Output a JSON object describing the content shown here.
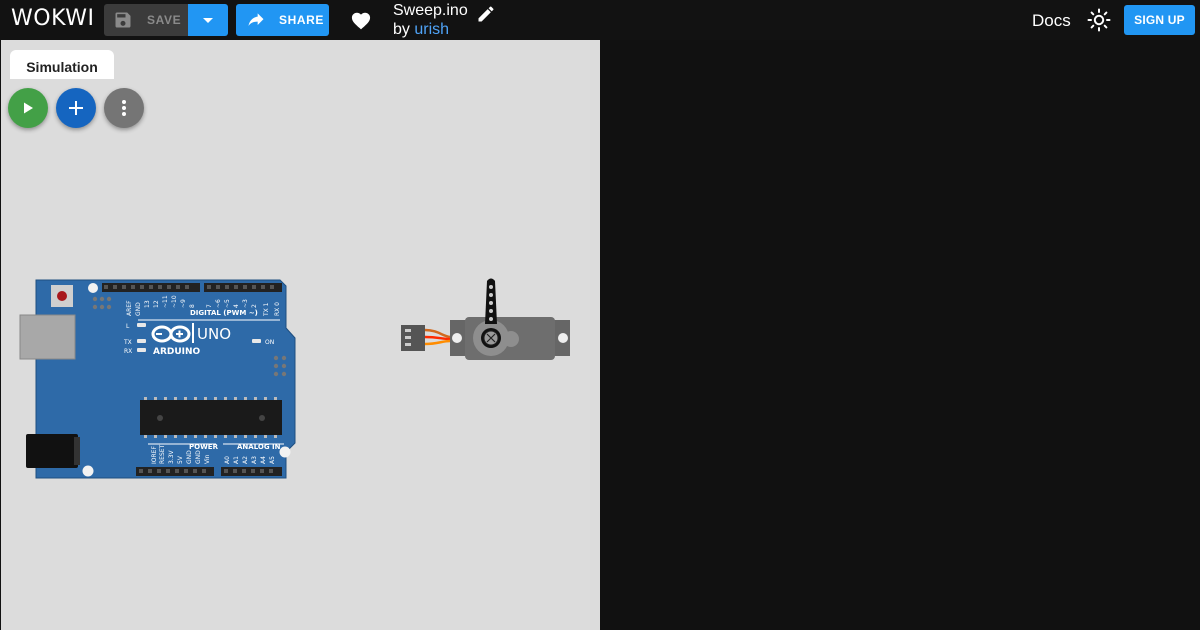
{
  "header": {
    "logo_text": "WOKWI",
    "save_label": "SAVE",
    "share_label": "SHARE",
    "project": {
      "name": "Sweep.ino",
      "by_prefix": "by",
      "author": "urish"
    },
    "docs_label": "Docs",
    "signup_label": "SIGN UP"
  },
  "simulation": {
    "tab_label": "Simulation",
    "controls": [
      "play-icon",
      "plus-icon",
      "more-vert-icon"
    ]
  },
  "board": {
    "brand": "ARDUINO",
    "model": "UNO",
    "digital_label": "DIGITAL (PWM ~)",
    "power_label": "POWER",
    "analog_label": "ANALOG IN",
    "on_label": "ON",
    "led_labels": [
      "L",
      "TX",
      "RX"
    ],
    "digital_pins": [
      "AREF",
      "GND",
      "13",
      "12",
      "~11",
      "~10",
      "~9",
      "8",
      "7",
      "~6",
      "~5",
      "4",
      "~3",
      "2",
      "TX 1",
      "RX 0"
    ],
    "power_pins": [
      "IOREF",
      "RESET",
      "3.3V",
      "5V",
      "GND",
      "GND",
      "Vin"
    ],
    "analog_pins": [
      "A0",
      "A1",
      "A2",
      "A3",
      "A4",
      "A5"
    ]
  },
  "colors": {
    "accent": "#2196f3",
    "run": "#43a047",
    "add": "#1565c0",
    "more": "#757575",
    "board_blue": "#2e6aa8",
    "canvas_bg": "#dcdcdc",
    "header_bg": "#121212"
  }
}
